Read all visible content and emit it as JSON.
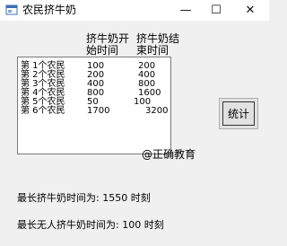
{
  "window": {
    "title": "农民挤牛奶",
    "minimize_glyph": "—",
    "maximize_glyph": "☐",
    "close_glyph": "✕"
  },
  "headers": {
    "start_line1": "挤牛奶开",
    "start_line2": "始时间",
    "end_line1": "挤牛奶结",
    "end_line2": "束时间"
  },
  "farmers": [
    {
      "name": "第 1个农民",
      "start": "100",
      "end": "200"
    },
    {
      "name": "第 2个农民",
      "start": "200",
      "end": "400"
    },
    {
      "name": "第 3个农民",
      "start": "400",
      "end": "800"
    },
    {
      "name": "第 4个农民",
      "start": "800",
      "end": "1600"
    },
    {
      "name": "第 5个农民",
      "start": "50",
      "end": "100"
    },
    {
      "name": "第 6个农民",
      "start": "1700",
      "end": "3200"
    }
  ],
  "button": {
    "label": "统计"
  },
  "watermark": "@正确教育",
  "results": {
    "longest_milking": "最长挤牛奶时间为:  1550 时刻",
    "longest_idle": "最长无人挤牛奶时间为:  100 时刻"
  }
}
